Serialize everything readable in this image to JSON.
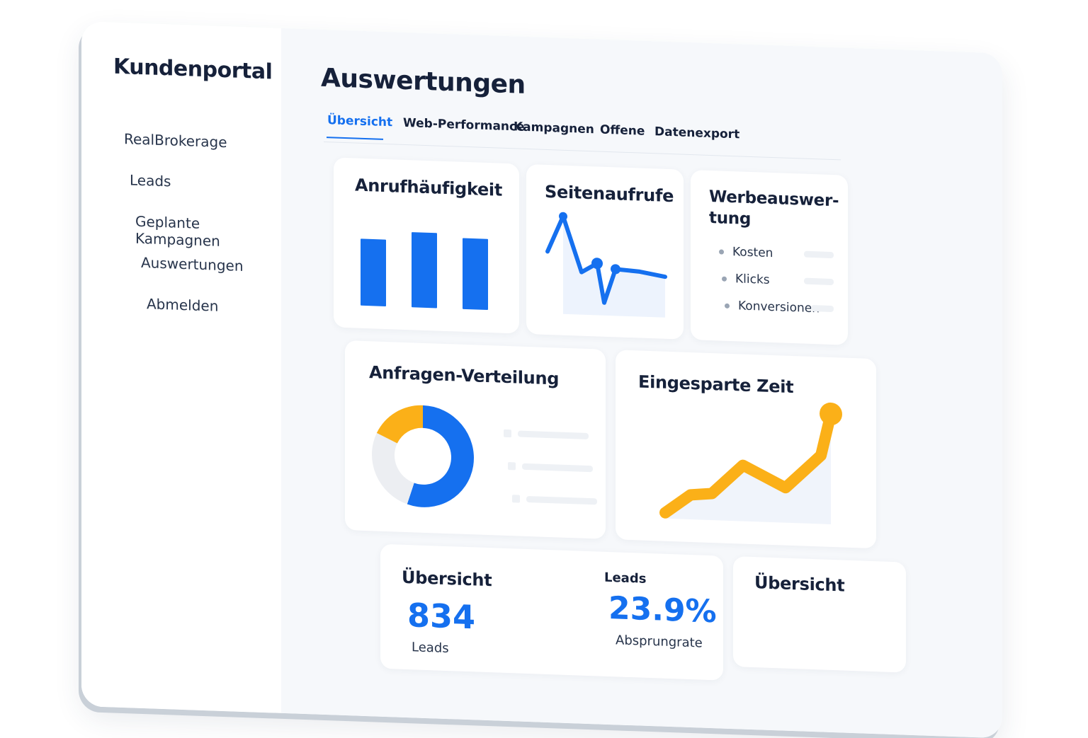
{
  "app": {
    "brand": "Kundenportal"
  },
  "sidebar": {
    "items": [
      {
        "label": "RealBrokerage"
      },
      {
        "label": "Leads"
      },
      {
        "label": "Geplante Kampagnen"
      },
      {
        "label": "Auswertungen"
      },
      {
        "label": "Abmelden"
      }
    ]
  },
  "page": {
    "title": "Auswertungen"
  },
  "tabs": [
    {
      "label": "Übersicht",
      "active": true
    },
    {
      "label": "Web-Performance"
    },
    {
      "label": "Kampagnen"
    },
    {
      "label": "Offene"
    },
    {
      "label": "Datenexport"
    }
  ],
  "cards": {
    "calls": {
      "title": "Anrufhäufigkeit"
    },
    "pageviews": {
      "title": "Seitenaufrufe"
    },
    "ads": {
      "title_line1": "Werbeauswer-",
      "title_line2": "tung",
      "legend": [
        "Kosten",
        "Klicks",
        "Konversionen"
      ]
    },
    "distribution": {
      "title": "Anfragen-Verteilung"
    },
    "saved": {
      "title": "Eingesparte Zeit"
    },
    "overview": {
      "title": "Übersicht",
      "leads_value": "834",
      "leads_label": "Leads",
      "rate_header": "Leads",
      "rate_value": "23.9%",
      "rate_label": "Absprungrate"
    },
    "overview2": {
      "title": "Übersicht"
    }
  },
  "colors": {
    "blue": "#1570ef",
    "orange": "#fbb018",
    "grey": "#eceef2"
  },
  "chart_data": [
    {
      "type": "bar",
      "values": [
        80,
        90,
        85
      ]
    },
    {
      "type": "line",
      "values": [
        58,
        100,
        35,
        46,
        0,
        40,
        38,
        33
      ]
    },
    {
      "type": "pie",
      "values": [
        55,
        27,
        18
      ],
      "colors": [
        "#1570ef",
        "#eceef2",
        "#fbb018"
      ]
    },
    {
      "type": "line",
      "values": [
        0,
        18,
        20,
        48,
        28,
        60,
        100
      ]
    }
  ]
}
